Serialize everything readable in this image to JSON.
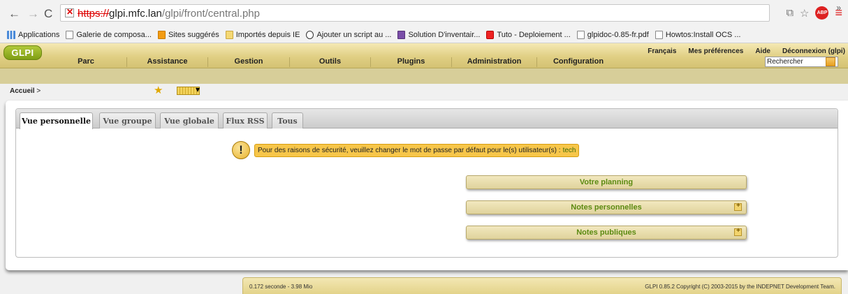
{
  "browser": {
    "url_protocol": "https://",
    "url_host": "glpi.mfc.lan",
    "url_path": "/glpi/front/central.php",
    "abp_label": "ABP"
  },
  "bookmarks": [
    {
      "label": "Applications",
      "icon": "apps-grid-icon"
    },
    {
      "label": "Galerie de composa...",
      "icon": "page-icon"
    },
    {
      "label": "Sites suggérés",
      "icon": "orange-bookmark-icon"
    },
    {
      "label": "Importés depuis IE",
      "icon": "folder-icon"
    },
    {
      "label": "Ajouter un script au ...",
      "icon": "face-icon"
    },
    {
      "label": "Solution D'inventair...",
      "icon": "purple-site-icon"
    },
    {
      "label": "Tuto - Deploiement ...",
      "icon": "youtube-icon"
    },
    {
      "label": "glpidoc-0.85-fr.pdf",
      "icon": "page-icon"
    },
    {
      "label": "Howtos:Install OCS ...",
      "icon": "page-icon"
    }
  ],
  "bookmarks_more": "»",
  "glpi": {
    "logo": "GLPI",
    "top_links": [
      "Français",
      "Mes préférences",
      "Aide",
      "Déconnexion (glpi)"
    ],
    "main_menu": [
      "Parc",
      "Assistance",
      "Gestion",
      "Outils",
      "Plugins",
      "Administration",
      "Configuration"
    ],
    "search_value": "Rechercher"
  },
  "breadcrumb": {
    "label": "Accueil",
    "sep": ">"
  },
  "tabs": [
    "Vue personnelle",
    "Vue groupe",
    "Vue globale",
    "Flux RSS",
    "Tous"
  ],
  "active_tab": "Vue personnelle",
  "warning": {
    "icon": "!",
    "message": "Pour des raisons de sécurité, veuillez changer le mot de passe par défaut pour le(s) utilisateur(s) :",
    "link": "tech"
  },
  "boxes": [
    {
      "label": "Votre planning",
      "has_add": false
    },
    {
      "label": "Notes personnelles",
      "has_add": true
    },
    {
      "label": "Notes publiques",
      "has_add": true
    }
  ],
  "footer": {
    "timing": "0.172 seconde - 3.98 Mio",
    "copyright": "GLPI 0.85.2 Copyright (C) 2003-2015 by the INDEPNET Development Team."
  }
}
